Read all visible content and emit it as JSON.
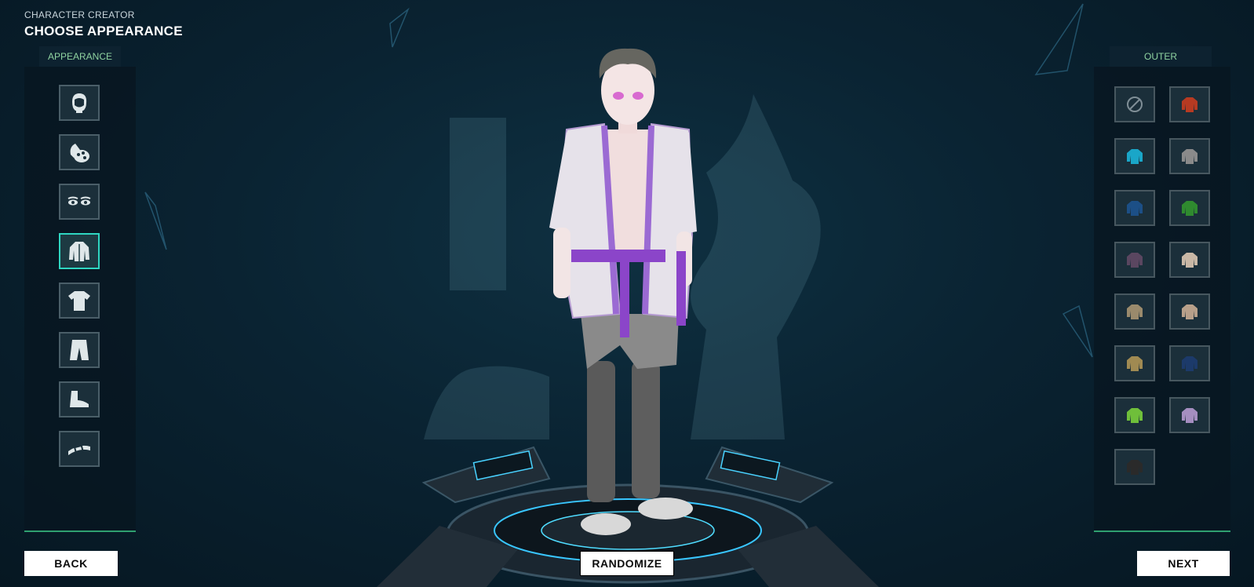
{
  "header": {
    "subtitle": "CHARACTER CREATOR",
    "title": "CHOOSE APPEARANCE"
  },
  "left_panel": {
    "tab_label": "APPEARANCE",
    "categories": [
      {
        "icon": "head-hair-icon"
      },
      {
        "icon": "skin-palette-icon"
      },
      {
        "icon": "eyes-icon"
      },
      {
        "icon": "jacket-icon",
        "selected": true
      },
      {
        "icon": "shirt-icon"
      },
      {
        "icon": "pants-icon"
      },
      {
        "icon": "shoes-icon"
      },
      {
        "icon": "belt-icon"
      }
    ]
  },
  "right_panel": {
    "tab_label": "OUTER",
    "items": [
      {
        "icon": "none-icon"
      },
      {
        "color": "#b73a22"
      },
      {
        "color": "#1aa6c8"
      },
      {
        "color": "#8a8a8a"
      },
      {
        "color": "#1c4f86"
      },
      {
        "color": "#2f8a2f"
      },
      {
        "color": "#5a4660"
      },
      {
        "color": "#c9b8a6"
      },
      {
        "color": "#9a8a6c"
      },
      {
        "color": "#b8a08a"
      },
      {
        "color": "#a08a52"
      },
      {
        "color": "#1c3a6a"
      },
      {
        "color": "#6fbf3a"
      },
      {
        "color": "#a58ec0"
      },
      {
        "color": "#2a2a2a"
      }
    ]
  },
  "buttons": {
    "back": "BACK",
    "randomize": "RANDOMIZE",
    "next": "NEXT"
  }
}
